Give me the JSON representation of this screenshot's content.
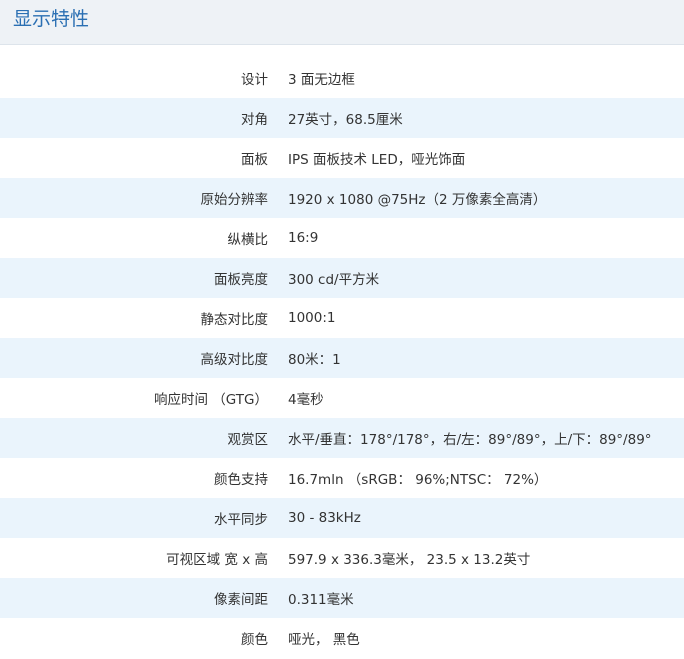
{
  "header": {
    "title": "显示特性"
  },
  "specs": [
    {
      "label": "设计",
      "value": "3 面无边框"
    },
    {
      "label": "对角",
      "value": "27英寸，68.5厘米"
    },
    {
      "label": "面板",
      "value": "IPS 面板技术 LED，哑光饰面"
    },
    {
      "label": "原始分辨率",
      "value": "1920 x 1080 @75Hz（2 万像素全高清）"
    },
    {
      "label": "纵横比",
      "value": "16:9"
    },
    {
      "label": "面板亮度",
      "value": "300 cd/平方米"
    },
    {
      "label": "静态对比度",
      "value": "1000:1"
    },
    {
      "label": "高级对比度",
      "value": "80米：1"
    },
    {
      "label": "响应时间 （GTG）",
      "value": "4毫秒"
    },
    {
      "label": "观赏区",
      "value": "水平/垂直：178°/178°，右/左：89°/89°，上/下：89°/89°"
    },
    {
      "label": "颜色支持",
      "value": "16.7mln （sRGB： 96%;NTSC： 72%）"
    },
    {
      "label": "水平同步",
      "value": "30 - 83kHz"
    },
    {
      "label": "可视区域 宽 x 高",
      "value": "597.9 x 336.3毫米， 23.5 x 13.2英寸"
    },
    {
      "label": "像素间距",
      "value": "0.311毫米"
    },
    {
      "label": "颜色",
      "value": "哑光， 黑色"
    }
  ]
}
